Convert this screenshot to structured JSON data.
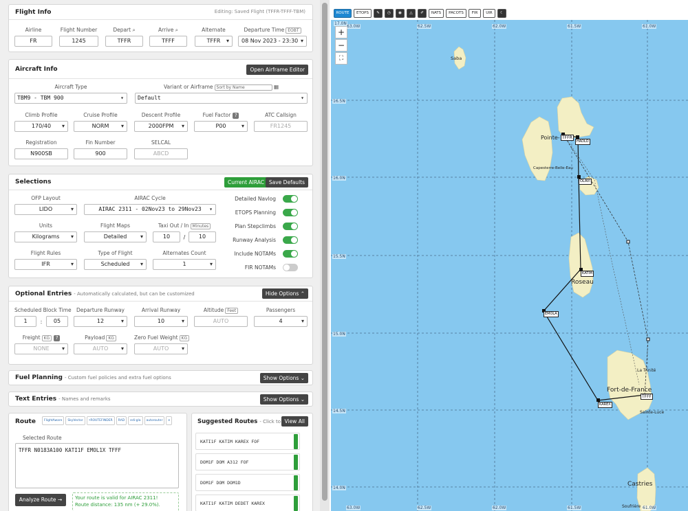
{
  "flight_info": {
    "title": "Flight Info",
    "editing": "Editing: Saved Flight (TFFR-TFFF-TBM)",
    "airline_label": "Airline",
    "airline": "FR",
    "flight_number_label": "Flight Number",
    "flight_number": "1245",
    "depart_label": "Depart",
    "depart": "TFFR",
    "arrive_label": "Arrive",
    "arrive": "TFFF",
    "alternate_label": "Alternate",
    "alternate": "TFFR",
    "dep_time_label": "Departure Time",
    "dep_time_tag": "EOBT",
    "dep_time": "08 Nov 2023 - 23:30"
  },
  "aircraft_info": {
    "title": "Aircraft Info",
    "editor_button": "Open Airframe Editor",
    "type_label": "Aircraft Type",
    "type": "TBM9 - TBM 900",
    "variant_label": "Variant or Airframe",
    "sort": "Sort by Name",
    "variant": "Default",
    "climb_label": "Climb Profile",
    "climb": "170/40",
    "cruise_label": "Cruise Profile",
    "cruise": "NORM",
    "descent_label": "Descent Profile",
    "descent": "2000FPM",
    "fuel_factor_label": "Fuel Factor",
    "fuel_factor": "P00",
    "atc_label": "ATC Callsign",
    "atc_placeholder": "FR1245",
    "reg_label": "Registration",
    "reg": "N900SB",
    "fin_label": "Fin Number",
    "fin": "900",
    "selcal_label": "SELCAL",
    "selcal_placeholder": "ABCD"
  },
  "selections": {
    "title": "Selections",
    "airac_button": "Current AIRAC",
    "defaults_button": "Save Defaults",
    "ofp_label": "OFP Layout",
    "ofp": "LIDO",
    "airac_label": "AIRAC Cycle",
    "airac": "AIRAC 2311 - 02Nov23 to 29Nov23",
    "units_label": "Units",
    "units": "Kilograms",
    "maps_label": "Flight Maps",
    "maps": "Detailed",
    "taxi_label": "Taxi Out / In",
    "taxi_tag": "Minutes",
    "taxi_out": "10",
    "taxi_in": "10",
    "rules_label": "Flight Rules",
    "rules": "IFR",
    "type_label": "Type of Flight",
    "type": "Scheduled",
    "alt_count_label": "Alternates Count",
    "alt_count": "1",
    "toggles": [
      {
        "label": "Detailed Navlog",
        "on": true
      },
      {
        "label": "ETOPS Planning",
        "on": true
      },
      {
        "label": "Plan Stepclimbs",
        "on": true
      },
      {
        "label": "Runway Analysis",
        "on": true
      },
      {
        "label": "Include NOTAMs",
        "on": true
      },
      {
        "label": "FIR NOTAMs",
        "on": false
      }
    ]
  },
  "optional": {
    "title": "Optional Entries",
    "subtitle": "- Automatically calculated, but can be customized",
    "hide_button": "Hide Options",
    "block_label": "Scheduled Block Time",
    "block_h": "1",
    "block_m": "05",
    "dep_rwy_label": "Departure Runway",
    "dep_rwy": "12",
    "arr_rwy_label": "Arrival Runway",
    "arr_rwy": "10",
    "alt_label": "Altitude",
    "alt_tag": "Feet",
    "alt_placeholder": "AUTO",
    "pax_label": "Passengers",
    "pax": "4",
    "freight_label": "Freight",
    "freight_tag": "KG",
    "freight": "NONE",
    "payload_label": "Payload",
    "payload_tag": "KG",
    "payload": "AUTO",
    "zfw_label": "Zero Fuel Weight",
    "zfw_tag": "KG",
    "zfw": "AUTO"
  },
  "fuel_planning": {
    "title": "Fuel Planning",
    "subtitle": "- Custom fuel policies and extra fuel options",
    "button": "Show Options"
  },
  "text_entries": {
    "title": "Text Entries",
    "subtitle": "- Names and remarks",
    "button": "Show Options"
  },
  "route": {
    "title": "Route",
    "selected_label": "Selected Route",
    "route_text": "TFFR N0183A100 KATI1F EMOL1X TFFF",
    "analyze_button": "Analyze Route →",
    "valid_text": "Your route is valid for AIRAC 2311!",
    "distance_text": "Route distance: 135 nm (+ 29.0%).",
    "logos": [
      "FlightAware",
      "SkyVector",
      "•ROUTEFINDER",
      "RAD",
      "edi-gla",
      "autorouter",
      "e"
    ]
  },
  "suggested": {
    "title": "Suggested Routes",
    "subtitle": "- Click to use",
    "view_all": "View All",
    "routes": [
      "KATI1F KATIM KAREX FOF",
      "DOM1F DOM A312 FOF",
      "DOM1F DOM DOM1D",
      "KATI1F KATIM DEDET KAREX"
    ]
  },
  "map": {
    "toolbar": [
      "ROUTE",
      "ETOPS",
      "✎",
      "◷",
      "◉",
      "△",
      "✐",
      "NATS",
      "PACOTS",
      "FIR",
      "UIR",
      "☾"
    ],
    "lon_labels": [
      "63.0W",
      "62.5W",
      "62.0W",
      "61.5W",
      "61.0W"
    ],
    "lat_labels": [
      "16.5N",
      "16.0N",
      "15.5N",
      "15.0N",
      "14.5N",
      "14.0N"
    ],
    "corner_label": "17.0N",
    "places": [
      "Saba",
      "Pointe-",
      "Capesterre-Belle-Eau",
      "Roseau",
      "La Trinité",
      "Fort-de-France",
      "Sainte-Luce",
      "Castries",
      "Soufrière"
    ],
    "waypoints": [
      "TFFR",
      "HADLO",
      "OLAVI",
      "KATIM",
      "EMOLA",
      "KAREX",
      "TFFF"
    ]
  }
}
